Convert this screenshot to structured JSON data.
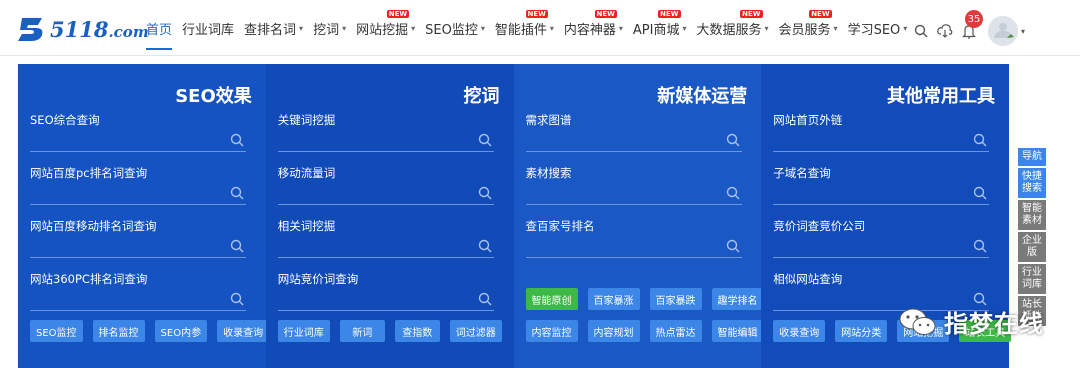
{
  "logo": {
    "text_main": "5118",
    "text_domain": ".com"
  },
  "nav": [
    {
      "label": "首页",
      "active": true,
      "caret": false,
      "new": false
    },
    {
      "label": "行业词库",
      "caret": false,
      "new": false
    },
    {
      "label": "查排名词",
      "caret": true,
      "new": false
    },
    {
      "label": "挖词",
      "caret": true,
      "new": false
    },
    {
      "label": "网站挖掘",
      "caret": true,
      "new": true
    },
    {
      "label": "SEO监控",
      "caret": true,
      "new": false
    },
    {
      "label": "智能插件",
      "caret": true,
      "new": true
    },
    {
      "label": "内容神器",
      "caret": true,
      "new": true
    },
    {
      "label": "API商城",
      "caret": true,
      "new": true
    },
    {
      "label": "大数据服务",
      "caret": true,
      "new": true
    },
    {
      "label": "会员服务",
      "caret": true,
      "new": true
    },
    {
      "label": "学习SEO",
      "caret": true,
      "new": false
    }
  ],
  "new_badge": "NEW",
  "caret_glyph": "▾",
  "notification_count": "35",
  "columns": [
    {
      "title": "SEO效果",
      "fields": [
        "SEO综合查询",
        "网站百度pc排名词查询",
        "网站百度移动排名词查询",
        "网站360PC排名词查询"
      ],
      "buttons": [
        "SEO监控",
        "排名监控",
        "SEO内参",
        "收录查询"
      ]
    },
    {
      "title": "挖词",
      "fields": [
        "关键词挖掘",
        "移动流量词",
        "相关词挖掘",
        "网站竞价词查询"
      ],
      "buttons": [
        "行业词库",
        "新词",
        "查指数",
        "词过滤器"
      ]
    },
    {
      "title": "新媒体运营",
      "fields": [
        "需求图谱",
        "素材搜索",
        "查百家号排名"
      ],
      "buttons_top": [
        "智能原创",
        "百家暴涨",
        "百家暴跌",
        "趣学排名"
      ],
      "buttons": [
        "内容监控",
        "内容规划",
        "热点雷达",
        "智能编辑"
      ]
    },
    {
      "title": "其他常用工具",
      "fields": [
        "网站首页外链",
        "子域名查询",
        "竞价词查竞价公司",
        "相似网站查询"
      ],
      "buttons": [
        "收录查询",
        "网站分类",
        "网站挖掘",
        "站长工具"
      ]
    }
  ],
  "sidebar": [
    {
      "label": "导航",
      "color": "blue"
    },
    {
      "label": "快捷搜索",
      "color": "blue"
    },
    {
      "label": "智能素材",
      "color": "grey"
    },
    {
      "label": "企业版",
      "color": "grey"
    },
    {
      "label": "行业词库",
      "color": "grey"
    },
    {
      "label": "站长插件",
      "color": "grey"
    }
  ],
  "watermark": {
    "text": "指梦在线"
  },
  "colors": {
    "brand_blue": "#1a6ad8",
    "panel_blue": "#1147b4",
    "chip_blue": "#3c86e8",
    "chip_green": "#3dba45",
    "badge_red": "#e22222"
  }
}
